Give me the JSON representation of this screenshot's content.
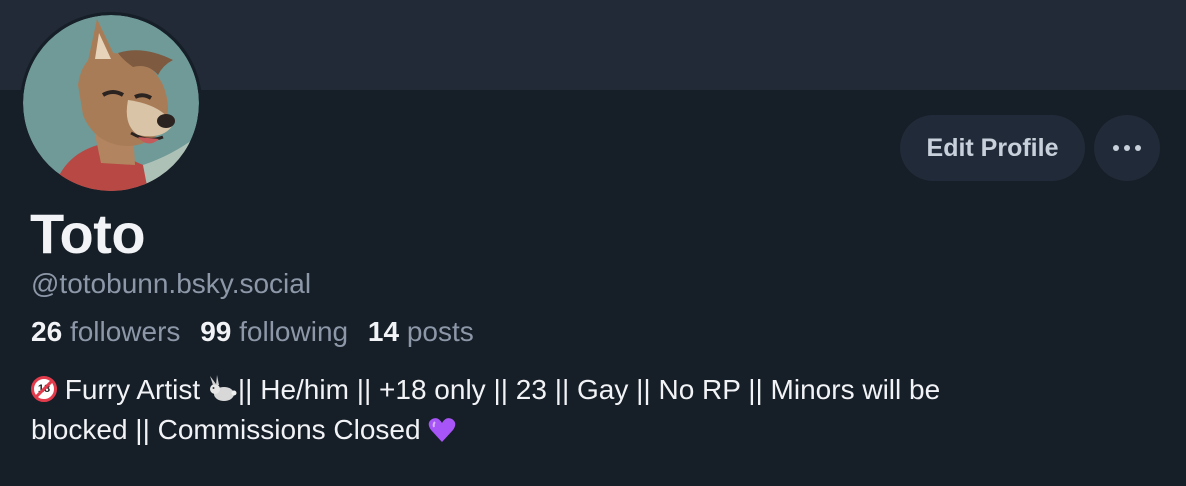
{
  "profile": {
    "display_name": "Toto",
    "handle": "@totobunn.bsky.social",
    "avatar_icon": "fox-avatar-illustration"
  },
  "actions": {
    "edit_label": "Edit Profile",
    "more_icon": "ellipsis-icon"
  },
  "stats": [
    {
      "count": "26",
      "label": "followers"
    },
    {
      "count": "99",
      "label": "following"
    },
    {
      "count": "14",
      "label": "posts"
    }
  ],
  "bio": {
    "line1_icon": "no-under-18-icon",
    "line1_a": "Furry Artist",
    "line1_icon2": "rabbit-icon",
    "line1_b": "|| He/him || +18 only || 23 || Gay || No RP || Minors will be",
    "line2": "blocked || Commissions Closed",
    "line2_icon": "purple-heart-icon"
  },
  "colors": {
    "background": "#161e27",
    "banner": "#222a38",
    "button_bg": "#212a38",
    "text_primary": "#f1f3f6",
    "text_secondary": "#8c97a8",
    "heart": "#a855f7"
  }
}
